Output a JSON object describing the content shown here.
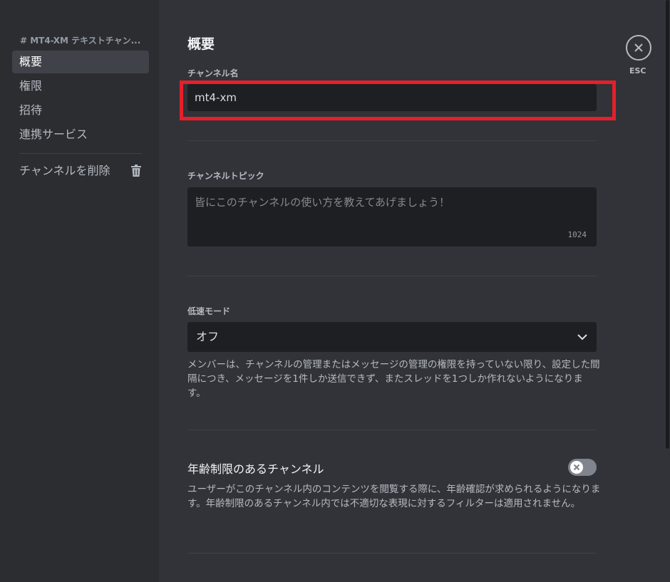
{
  "sidebar": {
    "header": "# MT4-XM テキストチャン...",
    "items": [
      {
        "label": "概要"
      },
      {
        "label": "権限"
      },
      {
        "label": "招待"
      },
      {
        "label": "連携サービス"
      }
    ],
    "delete_label": "チャンネルを削除"
  },
  "main": {
    "title": "概要",
    "channel_name_label": "チャンネル名",
    "channel_name_value": "mt4-xm",
    "topic_label": "チャンネルトピック",
    "topic_placeholder": "皆にこのチャンネルの使い方を教えてあげましょう！",
    "topic_char_count": "1024",
    "slowmode_label": "低速モード",
    "slowmode_value": "オフ",
    "slowmode_desc": "メンバーは、チャンネルの管理またはメッセージの管理の権限を持っていない限り、設定した間隔につき、メッセージを1件しか送信できず、またスレッドを1つしか作れないようになります。",
    "age_title": "年齢制限のあるチャンネル",
    "age_desc": "ユーザーがこのチャンネル内のコンテンツを閲覧する際に、年齢確認が求められるようになります。年齢制限のあるチャンネル内では不適切な表現に対するフィルターは適用されません。",
    "age_toggle_on": false,
    "esc_label": "ESC"
  },
  "colors": {
    "highlight": "#e5202a",
    "background": "#313338",
    "sidebar": "#2b2d31",
    "input": "#1e1f22"
  }
}
